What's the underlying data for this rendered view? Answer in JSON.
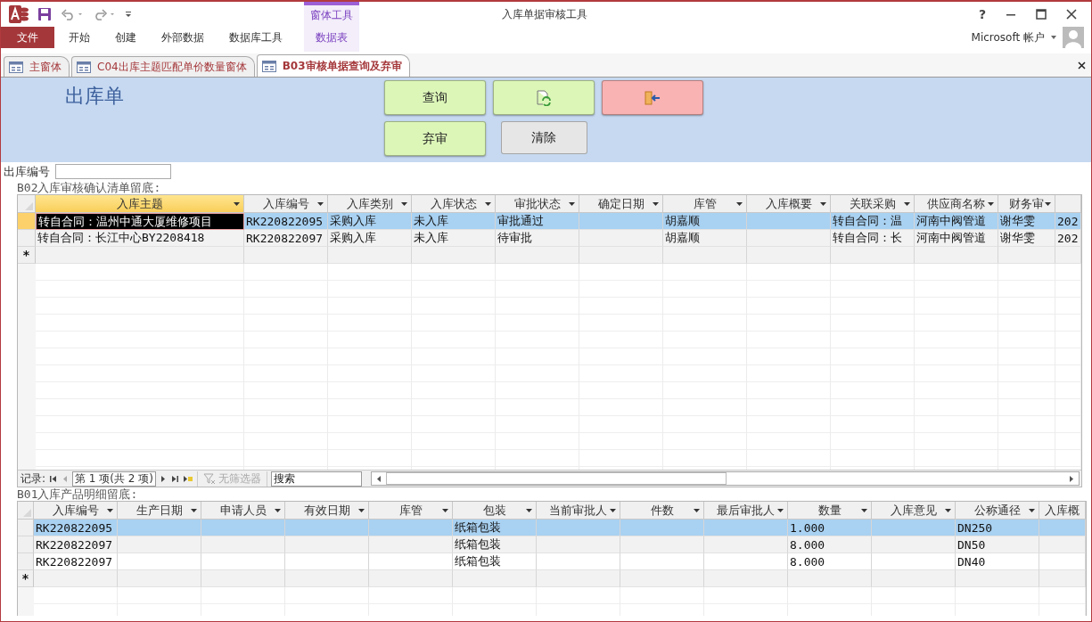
{
  "window": {
    "title": "入库单据审核工具",
    "help": "?"
  },
  "ribbon": {
    "context_group": "窗体工具",
    "tabs": [
      {
        "label": "文件",
        "kind": "file"
      },
      {
        "label": "开始",
        "kind": "tab"
      },
      {
        "label": "创建",
        "kind": "tab"
      },
      {
        "label": "外部数据",
        "kind": "tab"
      },
      {
        "label": "数据库工具",
        "kind": "tab"
      },
      {
        "label": "数据表",
        "kind": "context"
      }
    ]
  },
  "account": {
    "label": "Microsoft 帐户"
  },
  "doc_tabs": [
    {
      "label": "主窗体",
      "selected": false
    },
    {
      "label": "C04出库主题匹配单价数量窗体",
      "selected": false
    },
    {
      "label": "B03审核单据查询及弃审",
      "selected": true
    }
  ],
  "form": {
    "title": "出库单",
    "buttons": [
      {
        "kind": "text",
        "color": "#dcf6b8",
        "label": "查询"
      },
      {
        "kind": "refresh",
        "color": "#dcf6b8"
      },
      {
        "kind": "exit",
        "color": "#f9b3b3"
      },
      {
        "kind": "text",
        "color": "#dcf6b8",
        "label": "弃审"
      },
      {
        "kind": "text",
        "color": "#e6e6e6",
        "label": "清除"
      }
    ],
    "filter_field": {
      "label": "出库编号"
    }
  },
  "grids": [
    {
      "caption": "B02入库审核确认清单留底:",
      "new_row_marker": "*",
      "columns": [
        {
          "label": "入库主题",
          "active": true
        },
        {
          "label": "入库编号",
          "active": false
        },
        {
          "label": "入库类别",
          "active": false
        },
        {
          "label": "入库状态",
          "active": false
        },
        {
          "label": "审批状态",
          "active": false
        },
        {
          "label": "确定日期",
          "active": false
        },
        {
          "label": "库管",
          "active": false
        },
        {
          "label": "入库概要",
          "active": false
        },
        {
          "label": "关联采购",
          "active": false
        },
        {
          "label": "供应商名称",
          "active": false
        },
        {
          "label": "财务审",
          "active": false
        },
        {
          "active": false
        }
      ],
      "rows": [
        {
          "selected": true,
          "current": true,
          "cells": [
            "转自合同：温州中通大厦维修项目",
            "RK220822095",
            "采购入库",
            "未入库",
            "审批通过",
            null,
            "胡嘉顺",
            null,
            "转自合同：温",
            "河南中阀管道",
            "谢华雯",
            "202"
          ]
        },
        {
          "selected": false,
          "current": false,
          "cells": [
            "转自合同：长江中心BY2208418",
            "RK220822097",
            "采购入库",
            "未入库",
            "待审批",
            null,
            "胡嘉顺",
            null,
            "转自合同：长",
            "河南中阀管道",
            "谢华雯",
            "202"
          ]
        }
      ],
      "nav": {
        "label": "记录:",
        "position": "第 1 项(共 2 项)",
        "filter": {
          "label": "无筛选器",
          "disabled": true
        },
        "search": {
          "placeholder": "搜索"
        }
      }
    },
    {
      "caption": "B01入库产品明细留底:",
      "new_row_marker": "*",
      "columns": [
        {
          "label": "入库编号",
          "active": false
        },
        {
          "label": "生产日期",
          "active": false
        },
        {
          "label": "申请人员",
          "active": false
        },
        {
          "label": "有效日期",
          "active": false
        },
        {
          "label": "库管",
          "active": false
        },
        {
          "label": "包装",
          "active": false
        },
        {
          "label": "当前审批人",
          "active": false
        },
        {
          "label": "件数",
          "active": false
        },
        {
          "label": "最后审批人",
          "active": false
        },
        {
          "label": "数量",
          "active": false
        },
        {
          "label": "入库意见",
          "active": false
        },
        {
          "label": "公称通径",
          "active": false
        },
        {
          "label": "入库概",
          "active": false
        }
      ],
      "rows": [
        {
          "selected": true,
          "current": false,
          "cells": [
            "RK220822095",
            null,
            null,
            null,
            null,
            "纸箱包装",
            null,
            null,
            null,
            "1.000",
            null,
            "DN250",
            null
          ]
        },
        {
          "selected": false,
          "current": false,
          "cells": [
            "RK220822097",
            null,
            null,
            null,
            null,
            "纸箱包装",
            null,
            null,
            null,
            "8.000",
            null,
            "DN50",
            null
          ]
        },
        {
          "selected": false,
          "current": false,
          "cells": [
            "RK220822097",
            null,
            null,
            null,
            null,
            "纸箱包装",
            null,
            null,
            null,
            "8.000",
            null,
            "DN40",
            null
          ]
        }
      ]
    }
  ]
}
